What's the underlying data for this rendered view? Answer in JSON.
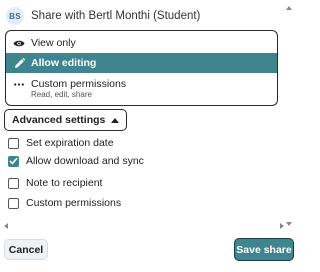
{
  "header": {
    "avatar_initials": "BS",
    "title": "Share with Bertl Monthi (Student)"
  },
  "permissions": {
    "options": [
      {
        "label": "View only",
        "icon": "eye-icon",
        "selected": false
      },
      {
        "label": "Allow editing",
        "icon": "pencil-icon",
        "selected": true
      },
      {
        "label": "Custom permissions",
        "description": "Read, edit, share",
        "icon": "more-horizontal-icon",
        "selected": false
      }
    ]
  },
  "advanced": {
    "label": "Advanced settings",
    "icon": "triangle-up-icon",
    "expanded": true
  },
  "settings": [
    {
      "label": "Set expiration date",
      "checked": false
    },
    {
      "label": "Allow download and sync",
      "checked": true
    },
    {
      "label": "Note to recipient",
      "checked": false
    },
    {
      "label": "Custom permissions",
      "checked": false
    }
  ],
  "footer": {
    "cancel_label": "Cancel",
    "save_label": "Save share"
  },
  "colors": {
    "accent": "#3f8590",
    "border_dark": "#2b2b2b",
    "avatar_bg": "#e3ecf5",
    "avatar_text": "#3a6aa0"
  }
}
